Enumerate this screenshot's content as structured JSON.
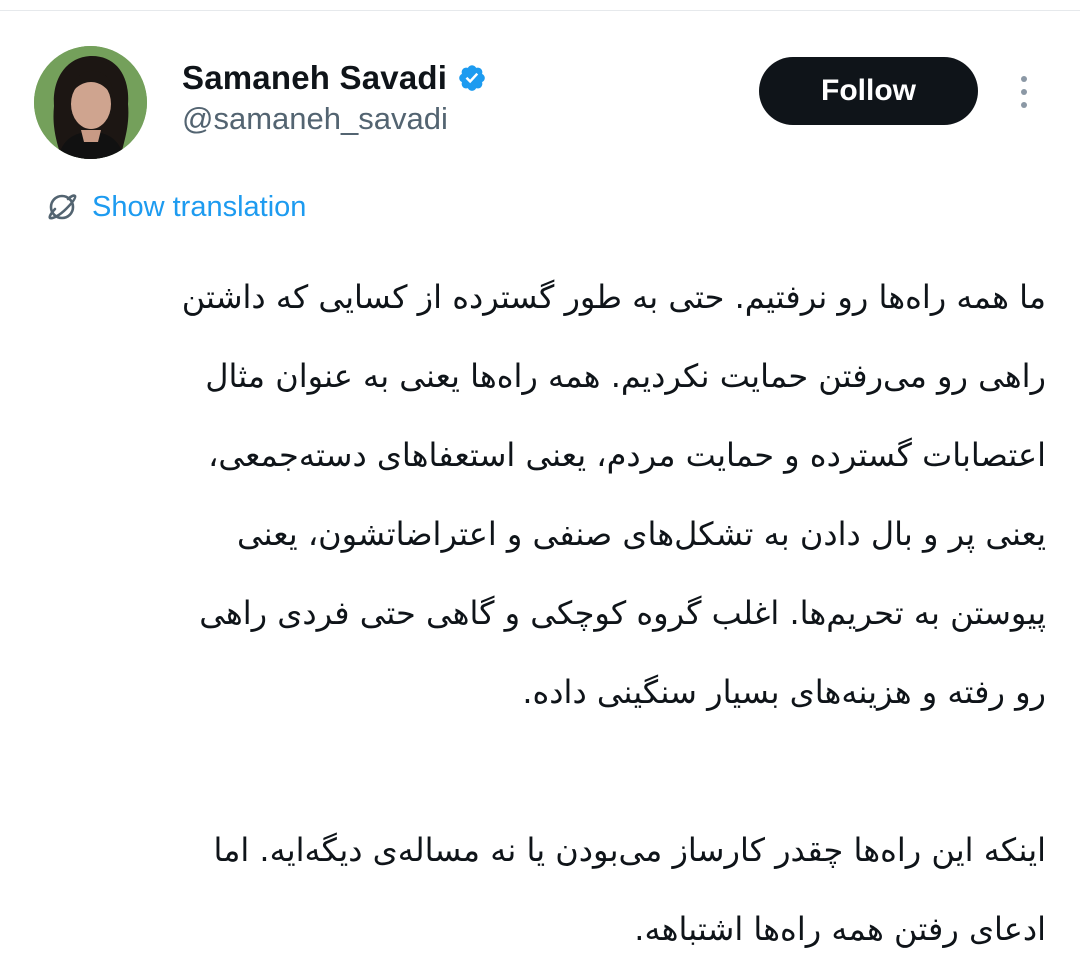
{
  "author": {
    "display_name": "Samaneh Savadi",
    "handle": "@samaneh_savadi",
    "verified": true,
    "verified_color": "#1d9bf0"
  },
  "actions": {
    "follow_label": "Follow"
  },
  "translation": {
    "label": "Show translation"
  },
  "tweet": {
    "paragraph_1": [
      "ما همه راه‌ها رو نرفتیم. حتی به طور گسترده از کسایی که داشتن",
      "راهی رو می‌رفتن حمایت نکردیم. همه راه‌ها یعنی به عنوان مثال",
      "اعتصابات گسترده و حمایت مردم، یعنی استعفاهای دسته‌جمعی،",
      "یعنی پر و بال دادن به تشکل‌های صنفی و اعتراضاتشون، یعنی",
      "پیوستن به تحریم‌ها. اغلب گروه کوچکی و گاهی حتی فردی راهی",
      "رو رفته و هزینه‌های بسیار سنگینی داده."
    ],
    "paragraph_2": [
      "اینکه این راه‌ها چقدر کارساز می‌بودن یا نه مساله‌ی دیگه‌ایه. اما",
      "ادعای رفتن همه راه‌ها اشتباهه."
    ]
  },
  "icons": {
    "avatar": "profile-photo",
    "verified": "verified-badge-icon",
    "more": "more-vertical-icon",
    "translate": "translate-globe-icon"
  },
  "colors": {
    "text_primary": "#0f1419",
    "text_secondary": "#536471",
    "accent": "#1d9bf0",
    "follow_bg": "#0f1419"
  }
}
